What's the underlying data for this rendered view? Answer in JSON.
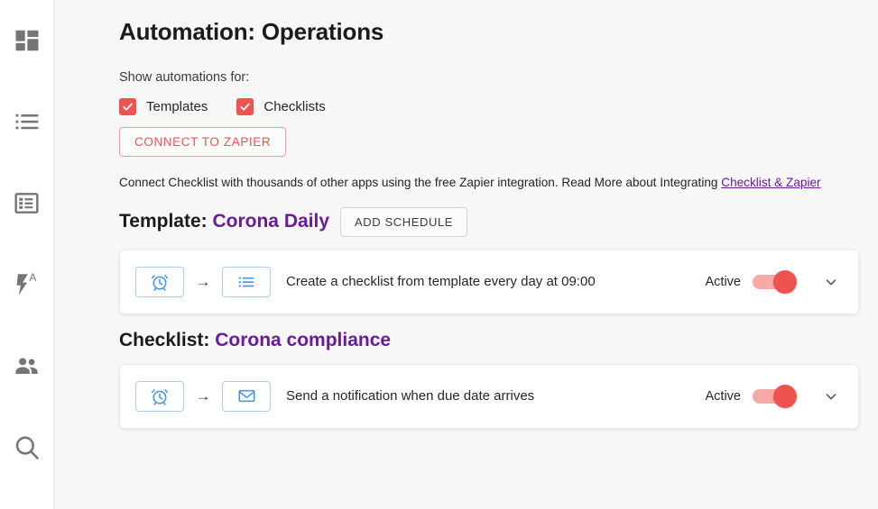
{
  "sidebar": {
    "items": [
      {
        "icon": "dashboard-grid-icon",
        "name": "sidebar-item-dashboard"
      },
      {
        "icon": "list-icon",
        "name": "sidebar-item-lists"
      },
      {
        "icon": "checklist-card-icon",
        "name": "sidebar-item-checklists"
      },
      {
        "icon": "automation-bolt-a-icon",
        "name": "sidebar-item-automation"
      },
      {
        "icon": "people-icon",
        "name": "sidebar-item-team"
      },
      {
        "icon": "search-icon",
        "name": "sidebar-item-search"
      }
    ]
  },
  "header": {
    "title": "Automation: Operations"
  },
  "filters": {
    "label": "Show automations for:",
    "checkboxes": [
      {
        "label": "Templates",
        "checked": true
      },
      {
        "label": "Checklists",
        "checked": true
      }
    ],
    "zapier_button": "CONNECT TO ZAPIER"
  },
  "intro": {
    "text": "Connect Checklist with thousands of other apps using the free Zapier integration. Read More about Integrating ",
    "link_text": "Checklist & Zapier"
  },
  "sections": [
    {
      "prefix": "Template:",
      "name": "Corona Daily",
      "button": "ADD SCHEDULE",
      "has_button": true,
      "rows": [
        {
          "trigger_icon": "alarm-clock-icon",
          "action_icon": "list-icon",
          "arrow": "→",
          "description": "Create a checklist from template every day at 09:00",
          "status": "Active",
          "enabled": true
        }
      ]
    },
    {
      "prefix": "Checklist:",
      "name": "Corona compliance",
      "button": "",
      "has_button": false,
      "rows": [
        {
          "trigger_icon": "alarm-clock-icon",
          "action_icon": "envelope-icon",
          "arrow": "→",
          "description": "Send a notification when due date arrives",
          "status": "Active",
          "enabled": true
        }
      ]
    }
  ],
  "colors": {
    "accent_red": "#ef5350",
    "accent_purple": "#6a1b9a",
    "icon_blue": "#4a9aeb",
    "page_bg": "#f7f7f8",
    "sidebar_icon": "#757575"
  }
}
